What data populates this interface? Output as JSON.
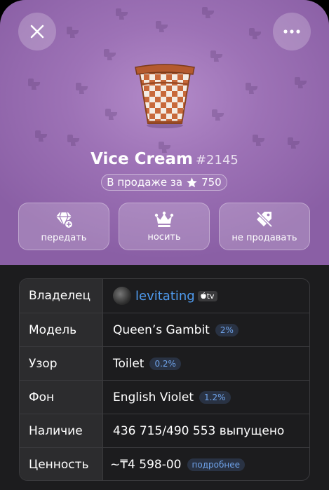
{
  "gift": {
    "name": "Vice Cream",
    "number": "#2145",
    "sale_prefix": "В продаже за",
    "sale_price": "750"
  },
  "actions": [
    {
      "label": "передать",
      "icon": "gift-transfer-icon"
    },
    {
      "label": "носить",
      "icon": "crown-icon"
    },
    {
      "label": "не продавать",
      "icon": "price-tag-off-icon"
    }
  ],
  "details": {
    "owner_label": "Владелец",
    "owner_name": "levitating",
    "owner_badge": "tv",
    "model_label": "Модель",
    "model_value": "Queen’s Gambit",
    "model_rarity": "2%",
    "pattern_label": "Узор",
    "pattern_value": "Toilet",
    "pattern_rarity": "0.2%",
    "backdrop_label": "Фон",
    "backdrop_value": "English Violet",
    "backdrop_rarity": "1.2%",
    "availability_label": "Наличие",
    "availability_value": "436 715/490 553 выпущено",
    "value_label": "Ценность",
    "value_value": "~₸4 598-00",
    "value_more": "подробнее"
  },
  "colors": {
    "backdrop": "#9d72b6",
    "accent": "#4f9bef",
    "sheet": "#1c1c1e"
  }
}
